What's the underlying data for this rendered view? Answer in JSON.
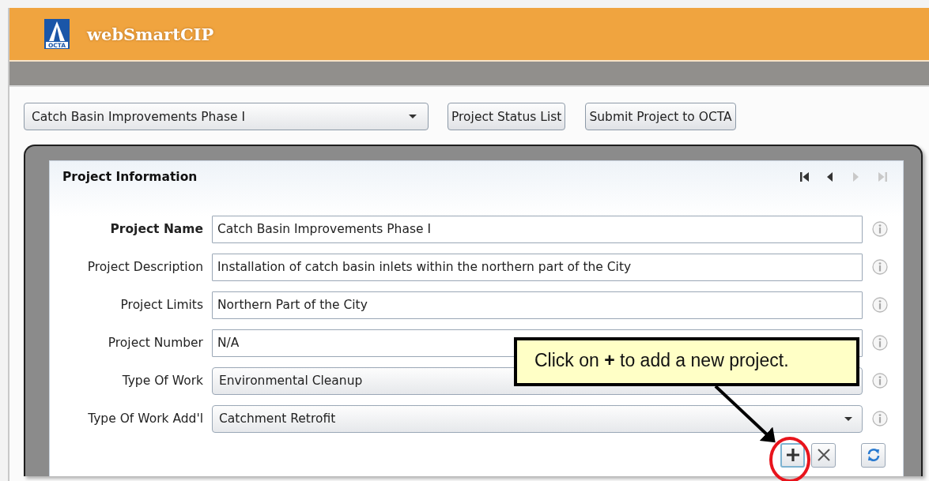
{
  "header": {
    "logo_text": "OCTA",
    "title": "webSmartCIP"
  },
  "toolbar": {
    "project_select": {
      "value": "Catch Basin Improvements Phase I"
    },
    "buttons": [
      "Project Status List",
      "Submit Project to OCTA"
    ]
  },
  "panel": {
    "title": "Project Information",
    "navigation": [
      {
        "kind": "first",
        "disabled": false
      },
      {
        "kind": "previous",
        "disabled": false
      },
      {
        "kind": "next",
        "disabled": true
      },
      {
        "kind": "last",
        "disabled": true
      }
    ],
    "fields": [
      {
        "label": "Project Name",
        "kind": "text",
        "required": true,
        "value": "Catch Basin Improvements Phase I"
      },
      {
        "label": "Project Description",
        "kind": "text",
        "required": false,
        "value": "Installation of catch basin inlets within the northern part of the City"
      },
      {
        "label": "Project Limits",
        "kind": "text",
        "required": false,
        "value": "Northern Part of the City"
      },
      {
        "label": "Project Number",
        "kind": "text",
        "required": false,
        "value": "N/A"
      },
      {
        "label": "Type Of Work",
        "kind": "dropdown",
        "required": false,
        "value": "Environmental Cleanup"
      },
      {
        "label": "Type Of Work Add'l",
        "kind": "dropdown",
        "required": false,
        "value": "Catchment Retrofit"
      }
    ],
    "actions": [
      {
        "kind": "add"
      },
      {
        "kind": "delete"
      },
      {
        "kind": "refresh"
      }
    ]
  },
  "callout": {
    "text": "Click on **+** to add a new project."
  }
}
